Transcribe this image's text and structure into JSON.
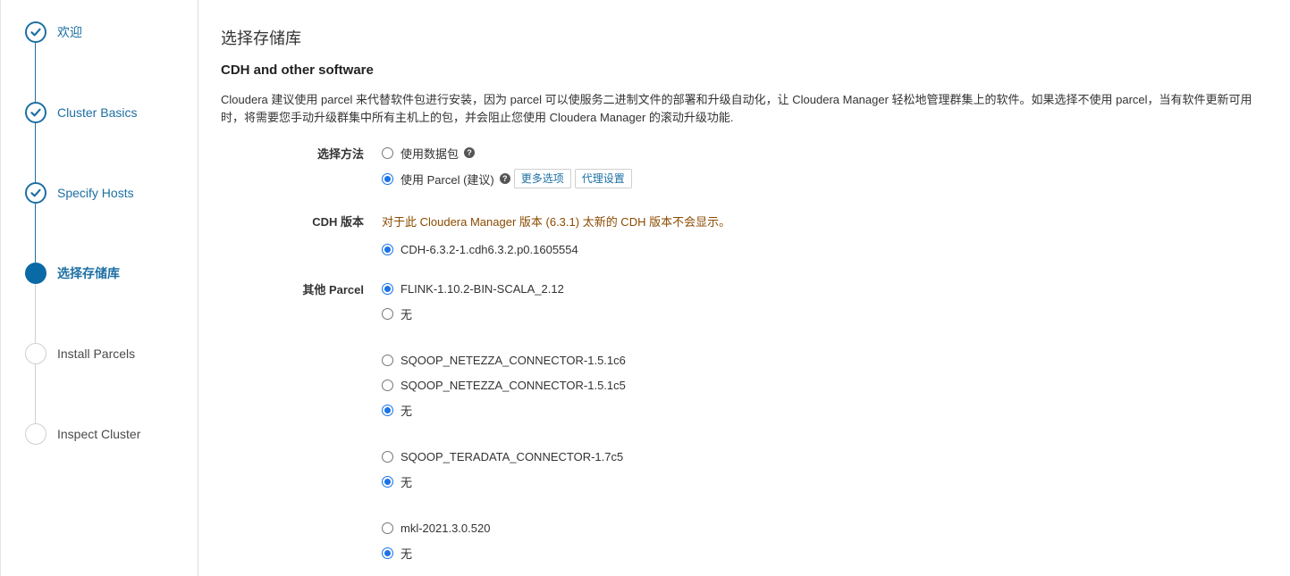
{
  "sidebar": {
    "steps": [
      {
        "label": "欢迎",
        "state": "done"
      },
      {
        "label": "Cluster Basics",
        "state": "done"
      },
      {
        "label": "Specify Hosts",
        "state": "done"
      },
      {
        "label": "选择存储库",
        "state": "active"
      },
      {
        "label": "Install Parcels",
        "state": "todo"
      },
      {
        "label": "Inspect Cluster",
        "state": "todo"
      }
    ]
  },
  "main": {
    "page_title": "选择存储库",
    "section_title": "CDH and other software",
    "description": "Cloudera 建议使用 parcel 来代替软件包进行安装，因为 parcel 可以使服务二进制文件的部署和升级自动化，让 Cloudera Manager 轻松地管理群集上的软件。如果选择不使用 parcel，当有软件更新可用时，将需要您手动升级群集中所有主机上的包，并会阻止您使用 Cloudera Manager 的滚动升级功能.",
    "method": {
      "label": "选择方法",
      "option_packages": "使用数据包",
      "option_parcel": "使用 Parcel (建议)",
      "more_options": "更多选项",
      "proxy_settings": "代理设置"
    },
    "cdh": {
      "label": "CDH 版本",
      "warning": "对于此 Cloudera Manager 版本 (6.3.1) 太新的 CDH 版本不会显示。",
      "option": "CDH-6.3.2-1.cdh6.3.2.p0.1605554"
    },
    "other": {
      "label": "其他 Parcel",
      "none": "无",
      "flink": "FLINK-1.10.2-BIN-SCALA_2.12",
      "sqoop_netezza_1": "SQOOP_NETEZZA_CONNECTOR-1.5.1c6",
      "sqoop_netezza_2": "SQOOP_NETEZZA_CONNECTOR-1.5.1c5",
      "sqoop_teradata": "SQOOP_TERADATA_CONNECTOR-1.7c5",
      "mkl": "mkl-2021.3.0.520"
    }
  },
  "colors": {
    "accent": "#1d6fa3",
    "warning": "#8a4a00",
    "radio": "#1a73e8"
  },
  "icons": {
    "done_step": "check-icon",
    "help": "question-circle-icon"
  }
}
